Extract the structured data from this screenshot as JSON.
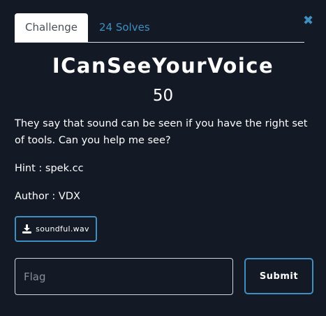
{
  "modal": {
    "close_icon": "close-icon",
    "tabs": [
      {
        "label": "Challenge",
        "active": true
      },
      {
        "label": "24 Solves",
        "active": false
      }
    ],
    "title": "ICanSeeYourVoice",
    "points": "50",
    "description": "They say that sound can be seen if you have the right set of tools. Can you help me see?",
    "hint": "Hint : spek.cc",
    "author": "Author : VDX",
    "file": {
      "label": "soundful.wav",
      "icon": "download-icon"
    },
    "flag_input": {
      "placeholder": "Flag",
      "value": ""
    },
    "submit_label": "Submit"
  },
  "colors": {
    "background": "#141926",
    "accent": "#3f8fc1",
    "text": "#ffffff",
    "active_tab_bg": "#ffffff",
    "active_tab_text": "#495057",
    "placeholder": "#8a8f99"
  }
}
